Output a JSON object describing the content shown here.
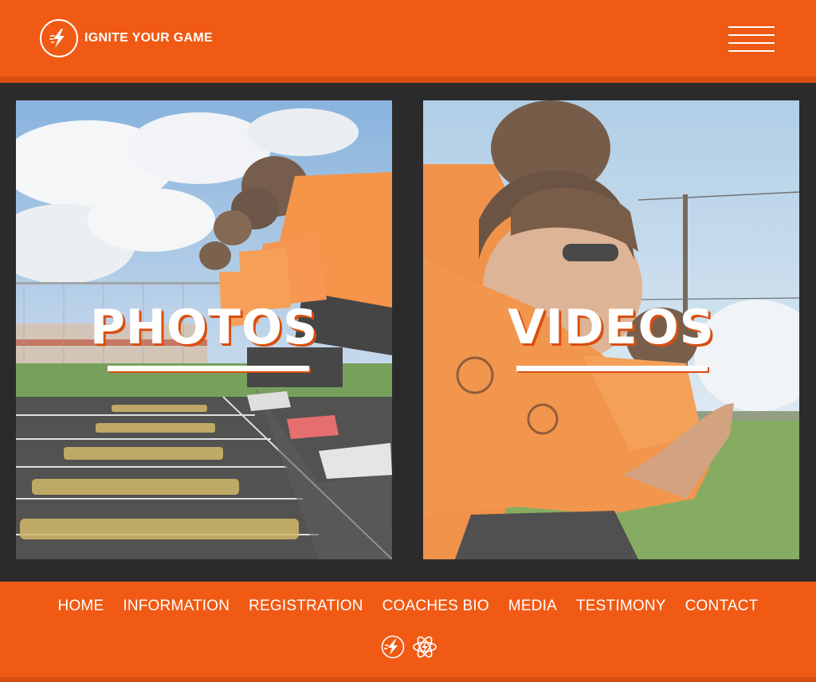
{
  "brand": {
    "name": "IGNITE YOUR GAME",
    "logo_icon": "lightning-circle-icon",
    "primary_color": "#f05a14",
    "dark_color": "#2b2b2b"
  },
  "header": {
    "menu_icon": "hamburger-menu-icon"
  },
  "panels": [
    {
      "title": "PHOTOS",
      "image": "athletes-crouched-at-track-start-line"
    },
    {
      "title": "VIDEOS",
      "image": "athlete-in-sunglasses-close-up"
    }
  ],
  "footer": {
    "nav": [
      "HOME",
      "INFORMATION",
      "REGISTRATION",
      "COACHES BIO",
      "MEDIA",
      "TESTIMONY",
      "CONTACT"
    ],
    "icons": [
      "lightning-circle-icon",
      "atom-bolt-icon"
    ]
  }
}
